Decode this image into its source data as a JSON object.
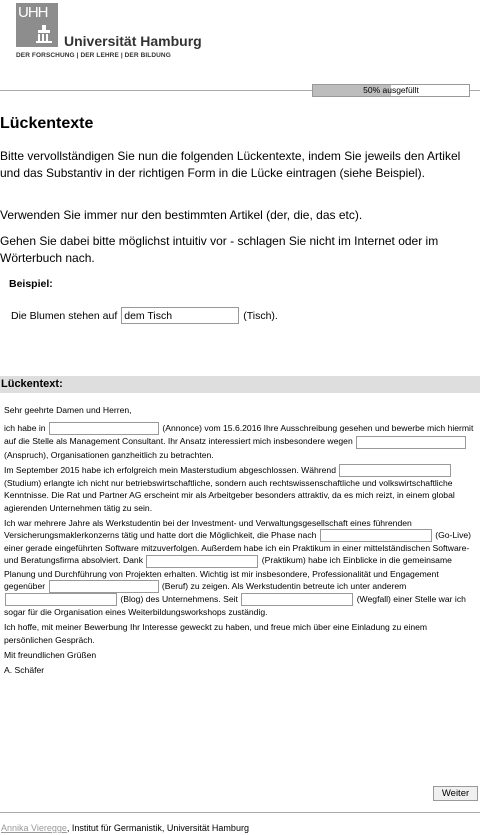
{
  "header": {
    "logo_mark": "UHH",
    "university_name": "Universität Hamburg",
    "motto": "DER FORSCHUNG | DER LEHRE | DER BILDUNG"
  },
  "progress": {
    "label": "50% ausgefüllt",
    "fraction": 0.5
  },
  "page": {
    "title": "Lückentexte",
    "intro1": "Bitte vervollständigen Sie nun die folgenden Lückentexte, indem Sie jeweils den Artikel und das Substantiv in der richtigen Form in die Lücke eintragen (siehe Beispiel).",
    "intro2": "Verwenden Sie immer nur den bestimmten Artikel (der, die, das etc).",
    "intro3": "Gehen Sie dabei bitte möglichst intuitiv vor - schlagen Sie nicht im Internet oder im Wörterbuch nach."
  },
  "example": {
    "title": "Beispiel:",
    "prefix": "Die Blumen stehen auf",
    "value": "dem Tisch",
    "suffix": "(Tisch)."
  },
  "section_title": "Lückentext:",
  "letter": {
    "greeting": "Sehr geehrte Damen und Herren,",
    "p1_a": "ich habe in",
    "p1_b": "(Annonce) vom 15.6.2016 Ihre Ausschreibung gesehen und bewerbe mich hiermit auf die Stelle als Management Consultant. Ihr Ansatz interessiert mich insbesondere wegen",
    "p1_c": "(Anspruch), Organisationen ganzheitlich zu betrachten.",
    "p2_a": "Im September 2015 habe ich erfolgreich mein Masterstudium abgeschlossen. Während",
    "p2_b": "(Studium) erlangte ich nicht nur betriebswirtschaftliche, sondern auch rechtswissenschaftliche und volkswirtschaftliche Kenntnisse. Die Rat und Partner AG erscheint mir als Arbeitgeber besonders attraktiv, da es mich reizt, in einem global agierenden Unternehmen tätig zu sein.",
    "p3_a": "Ich war mehrere Jahre als Werkstudentin bei der Investment- und Verwaltungsgesellschaft eines führenden Versicherungsmaklerkonzerns tätig und hatte dort die Möglichkeit, die Phase nach",
    "p3_b": "(Go-Live) einer gerade eingeführten Software mitzuverfolgen. Außerdem habe ich ein Praktikum in einer mittelständischen Software- und Beratungsfirma absolviert. Dank",
    "p3_c": "(Praktikum) habe ich Einblicke in die gemeinsame Planung und Durchführung von Projekten erhalten. Wichtig ist mir insbesondere, Professionalität und Engagement gegenüber",
    "p3_d": "(Beruf) zu zeigen. Als Werkstudentin betreute ich unter anderem",
    "p3_e": "(Blog) des Unternehmens. Seit",
    "p3_f": "(Wegfall) einer Stelle war ich sogar für die Organisation eines Weiterbildungsworkshops zuständig.",
    "p4": "Ich hoffe, mit meiner Bewerbung Ihr Interesse geweckt zu haben, und freue mich über eine Einladung zu einem persönlichen Gespräch.",
    "closing": "Mit freundlichen Grüßen",
    "signature": "A. Schäfer"
  },
  "next_button": "Weiter",
  "footer": {
    "author": "Annika Vieregge",
    "affiliation": ", Institut für Germanistik, Universität Hamburg"
  }
}
